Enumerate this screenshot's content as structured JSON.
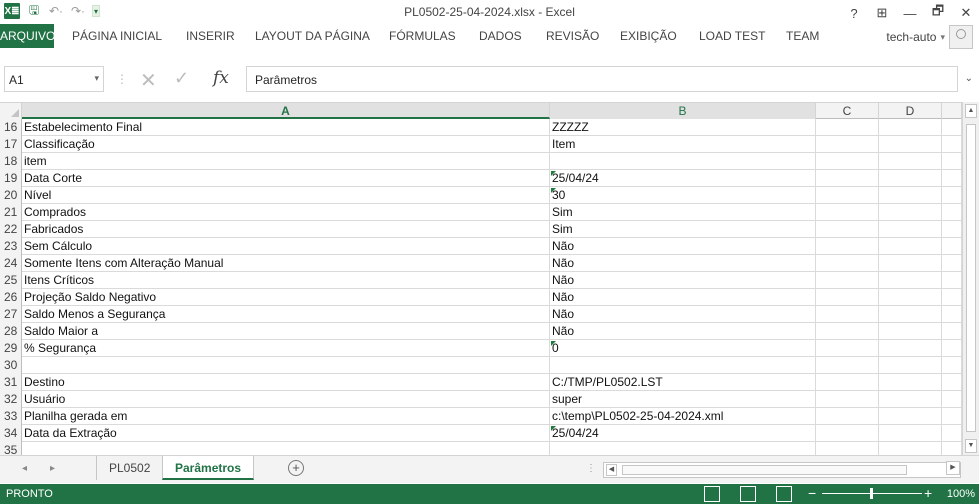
{
  "window": {
    "title": "PL0502-25-04-2024.xlsx - Excel",
    "controls": {
      "help": "?",
      "options": "⊞",
      "minimize": "—",
      "restore": "🗗",
      "close": "✕"
    }
  },
  "qat": {
    "logo": "X≣",
    "save": "🖫",
    "undo": "↶·",
    "redo": "↷·",
    "customize": "▾"
  },
  "ribbon": {
    "tabs": [
      "ARQUIVO",
      "PÁGINA INICIAL",
      "INSERIR",
      "LAYOUT DA PÁGINA",
      "FÓRMULAS",
      "DADOS",
      "REVISÃO",
      "EXIBIÇÃO",
      "LOAD TEST",
      "TEAM"
    ],
    "user": "tech-auto",
    "user_dropdown": "▾"
  },
  "formula_bar": {
    "name_box": "A1",
    "name_box_dropdown": "▾",
    "separator": "⋮",
    "cancel": "✕",
    "enter": "✓",
    "fx": "fx",
    "value": "Parâmetros",
    "expand": "⌄"
  },
  "grid": {
    "columns": [
      "A",
      "B",
      "C",
      "D"
    ],
    "selected_column": "A",
    "rows": [
      {
        "num": "16",
        "a": "Estabelecimento Final",
        "b": "ZZZZZ",
        "flag": false
      },
      {
        "num": "17",
        "a": "Classificação",
        "b": "Item",
        "flag": false
      },
      {
        "num": "18",
        "a": "item",
        "b": "",
        "flag": false
      },
      {
        "num": "19",
        "a": "Data Corte",
        "b": "25/04/24",
        "flag": true
      },
      {
        "num": "20",
        "a": "Nível",
        "b": "30",
        "flag": true
      },
      {
        "num": "21",
        "a": "Comprados",
        "b": "Sim",
        "flag": false
      },
      {
        "num": "22",
        "a": "Fabricados",
        "b": "Sim",
        "flag": false
      },
      {
        "num": "23",
        "a": "Sem Cálculo",
        "b": "Não",
        "flag": false
      },
      {
        "num": "24",
        "a": "Somente Itens com Alteração Manual",
        "b": "Não",
        "flag": false
      },
      {
        "num": "25",
        "a": "Itens Críticos",
        "b": "Não",
        "flag": false
      },
      {
        "num": "26",
        "a": "Projeção Saldo Negativo",
        "b": "Não",
        "flag": false
      },
      {
        "num": "27",
        "a": "Saldo Menos a Segurança",
        "b": "Não",
        "flag": false
      },
      {
        "num": "28",
        "a": "Saldo Maior a",
        "b": "Não",
        "flag": false
      },
      {
        "num": "29",
        "a": "% Segurança",
        "b": "0",
        "flag": true
      },
      {
        "num": "30",
        "a": "",
        "b": "",
        "flag": false
      },
      {
        "num": "31",
        "a": "Destino",
        "b": "C:/TMP/PL0502.LST",
        "flag": false
      },
      {
        "num": "32",
        "a": "Usuário",
        "b": "super",
        "flag": false
      },
      {
        "num": "33",
        "a": "Planilha gerada em",
        "b": "c:\\temp\\PL0502-25-04-2024.xml",
        "flag": false
      },
      {
        "num": "34",
        "a": "Data da Extração",
        "b": "25/04/24",
        "flag": true
      },
      {
        "num": "35",
        "a": "",
        "b": "",
        "flag": false
      }
    ]
  },
  "sheets": {
    "nav_prev": "◂",
    "nav_next": "▸",
    "tabs": [
      "PL0502",
      "Parâmetros"
    ],
    "active": "Parâmetros",
    "add": "+",
    "more": "⋮"
  },
  "scrollbars": {
    "up": "▲",
    "down": "▼",
    "left": "◀",
    "right": "▶"
  },
  "status": {
    "text": "PRONTO",
    "zoom_minus": "−",
    "zoom_plus": "+",
    "zoom_level": "100%"
  },
  "colors": {
    "excel_green": "#217346",
    "flag_green": "#1e7d3a"
  }
}
